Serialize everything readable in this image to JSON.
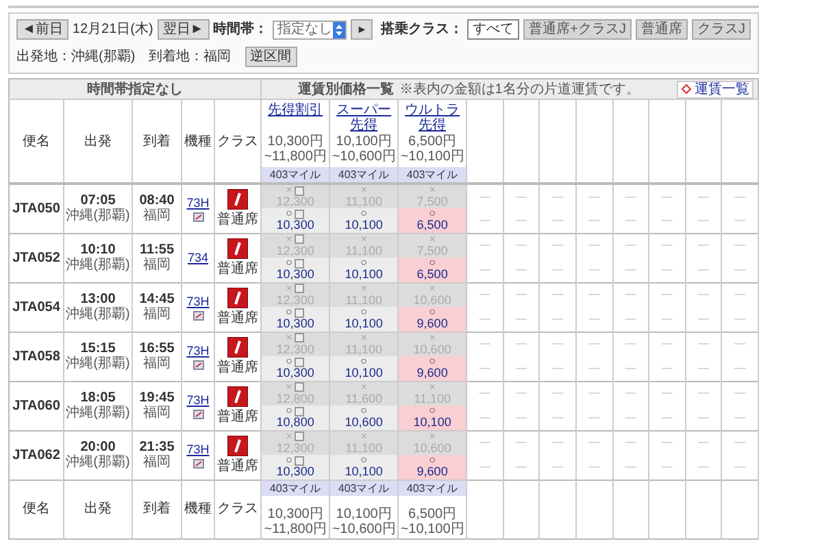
{
  "controls": {
    "prev_day": "◄前日",
    "date": "12月21日(木)",
    "next_day": "翌日►",
    "time_label": "時間帯：",
    "time_select": "指定なし",
    "go": "►",
    "class_label": "搭乗クラス：",
    "class_filters": [
      {
        "label": "すべて",
        "selected": true
      },
      {
        "label": "普通席+クラスJ",
        "selected": false
      },
      {
        "label": "普通席",
        "selected": false
      },
      {
        "label": "クラスJ",
        "selected": false
      }
    ],
    "origin": "出発地：沖縄(那覇)",
    "destination": "到着地：福岡",
    "reverse": "逆区間"
  },
  "table": {
    "time_header": "時間帯指定なし",
    "fare_header": "運賃別価格一覧",
    "fare_note": "※表内の金額は1名分の片道運賃です。",
    "fare_list_link": "運賃一覧",
    "columns": [
      "便名",
      "出発",
      "到着",
      "機種",
      "クラス"
    ],
    "fare_columns": [
      {
        "name": "先得割引",
        "price_from": "10,300円",
        "price_to": "~11,800円",
        "miles": "403マイル"
      },
      {
        "name": "スーパー先得",
        "price_from": "10,100円",
        "price_to": "~10,600円",
        "miles": "403マイル"
      },
      {
        "name": "ウルトラ先得",
        "price_from": "6,500円",
        "price_to": "~10,100円",
        "miles": "403マイル"
      }
    ],
    "flights": [
      {
        "number": "JTA050",
        "dep_time": "07:05",
        "dep_airport": "沖縄(那覇)",
        "arr_time": "08:40",
        "arr_airport": "福岡",
        "aircraft": "73H",
        "seatmap": true,
        "cabin": "普通席",
        "fares": [
          [
            {
              "mark": "×",
              "price": "12,300",
              "available": false,
              "badge": true,
              "lowest": false
            },
            {
              "mark": "○",
              "price": "10,300",
              "available": true,
              "badge": true,
              "lowest": false
            }
          ],
          [
            {
              "mark": "×",
              "price": "11,100",
              "available": false,
              "badge": false,
              "lowest": false
            },
            {
              "mark": "○",
              "price": "10,100",
              "available": true,
              "badge": false,
              "lowest": false
            }
          ],
          [
            {
              "mark": "×",
              "price": "7,500",
              "available": false,
              "badge": false,
              "lowest": false
            },
            {
              "mark": "○",
              "price": "6,500",
              "available": true,
              "badge": false,
              "lowest": true
            }
          ]
        ],
        "others": [
          [
            "—",
            "—"
          ],
          [
            "—",
            "—"
          ],
          [
            "—",
            "—"
          ],
          [
            "—",
            "—"
          ],
          [
            "—",
            "—"
          ],
          [
            "—",
            "—"
          ],
          [
            "—",
            "—"
          ],
          [
            "—",
            "—"
          ]
        ]
      },
      {
        "number": "JTA052",
        "dep_time": "10:10",
        "dep_airport": "沖縄(那覇)",
        "arr_time": "11:55",
        "arr_airport": "福岡",
        "aircraft": "734",
        "seatmap": false,
        "cabin": "普通席",
        "fares": [
          [
            {
              "mark": "×",
              "price": "12,300",
              "available": false,
              "badge": true,
              "lowest": false
            },
            {
              "mark": "○",
              "price": "10,300",
              "available": true,
              "badge": true,
              "lowest": false
            }
          ],
          [
            {
              "mark": "×",
              "price": "11,100",
              "available": false,
              "badge": false,
              "lowest": false
            },
            {
              "mark": "○",
              "price": "10,100",
              "available": true,
              "badge": false,
              "lowest": false
            }
          ],
          [
            {
              "mark": "×",
              "price": "7,500",
              "available": false,
              "badge": false,
              "lowest": false
            },
            {
              "mark": "○",
              "price": "6,500",
              "available": true,
              "badge": false,
              "lowest": true
            }
          ]
        ],
        "others": [
          [
            "—",
            "—"
          ],
          [
            "—",
            "—"
          ],
          [
            "—",
            "—"
          ],
          [
            "—",
            "—"
          ],
          [
            "—",
            "—"
          ],
          [
            "—",
            "—"
          ],
          [
            "—",
            "—"
          ],
          [
            "—",
            "—"
          ]
        ]
      },
      {
        "number": "JTA054",
        "dep_time": "13:00",
        "dep_airport": "沖縄(那覇)",
        "arr_time": "14:45",
        "arr_airport": "福岡",
        "aircraft": "73H",
        "seatmap": true,
        "cabin": "普通席",
        "fares": [
          [
            {
              "mark": "×",
              "price": "12,300",
              "available": false,
              "badge": true,
              "lowest": false
            },
            {
              "mark": "○",
              "price": "10,300",
              "available": true,
              "badge": true,
              "lowest": false
            }
          ],
          [
            {
              "mark": "×",
              "price": "11,100",
              "available": false,
              "badge": false,
              "lowest": false
            },
            {
              "mark": "○",
              "price": "10,100",
              "available": true,
              "badge": false,
              "lowest": false
            }
          ],
          [
            {
              "mark": "×",
              "price": "10,600",
              "available": false,
              "badge": false,
              "lowest": false
            },
            {
              "mark": "○",
              "price": "9,600",
              "available": true,
              "badge": false,
              "lowest": true
            }
          ]
        ],
        "others": [
          [
            "—",
            "—"
          ],
          [
            "—",
            "—"
          ],
          [
            "—",
            "—"
          ],
          [
            "—",
            "—"
          ],
          [
            "—",
            "—"
          ],
          [
            "—",
            "—"
          ],
          [
            "—",
            "—"
          ],
          [
            "—",
            "—"
          ]
        ]
      },
      {
        "number": "JTA058",
        "dep_time": "15:15",
        "dep_airport": "沖縄(那覇)",
        "arr_time": "16:55",
        "arr_airport": "福岡",
        "aircraft": "73H",
        "seatmap": true,
        "cabin": "普通席",
        "fares": [
          [
            {
              "mark": "×",
              "price": "12,300",
              "available": false,
              "badge": true,
              "lowest": false
            },
            {
              "mark": "○",
              "price": "10,300",
              "available": true,
              "badge": true,
              "lowest": false
            }
          ],
          [
            {
              "mark": "×",
              "price": "11,100",
              "available": false,
              "badge": false,
              "lowest": false
            },
            {
              "mark": "○",
              "price": "10,100",
              "available": true,
              "badge": false,
              "lowest": false
            }
          ],
          [
            {
              "mark": "×",
              "price": "10,600",
              "available": false,
              "badge": false,
              "lowest": false
            },
            {
              "mark": "○",
              "price": "9,600",
              "available": true,
              "badge": false,
              "lowest": true
            }
          ]
        ],
        "others": [
          [
            "—",
            "—"
          ],
          [
            "—",
            "—"
          ],
          [
            "—",
            "—"
          ],
          [
            "—",
            "—"
          ],
          [
            "—",
            "—"
          ],
          [
            "—",
            "—"
          ],
          [
            "—",
            "—"
          ],
          [
            "—",
            "—"
          ]
        ]
      },
      {
        "number": "JTA060",
        "dep_time": "18:05",
        "dep_airport": "沖縄(那覇)",
        "arr_time": "19:45",
        "arr_airport": "福岡",
        "aircraft": "73H",
        "seatmap": true,
        "cabin": "普通席",
        "fares": [
          [
            {
              "mark": "×",
              "price": "12,800",
              "available": false,
              "badge": true,
              "lowest": false
            },
            {
              "mark": "○",
              "price": "10,800",
              "available": true,
              "badge": true,
              "lowest": false
            }
          ],
          [
            {
              "mark": "×",
              "price": "11,600",
              "available": false,
              "badge": false,
              "lowest": false
            },
            {
              "mark": "○",
              "price": "10,600",
              "available": true,
              "badge": false,
              "lowest": false
            }
          ],
          [
            {
              "mark": "×",
              "price": "11,100",
              "available": false,
              "badge": false,
              "lowest": false
            },
            {
              "mark": "○",
              "price": "10,100",
              "available": true,
              "badge": false,
              "lowest": true
            }
          ]
        ],
        "others": [
          [
            "—",
            "—"
          ],
          [
            "—",
            "—"
          ],
          [
            "—",
            "—"
          ],
          [
            "—",
            "—"
          ],
          [
            "—",
            "—"
          ],
          [
            "—",
            "—"
          ],
          [
            "—",
            "—"
          ],
          [
            "—",
            "—"
          ]
        ]
      },
      {
        "number": "JTA062",
        "dep_time": "20:00",
        "dep_airport": "沖縄(那覇)",
        "arr_time": "21:35",
        "arr_airport": "福岡",
        "aircraft": "73H",
        "seatmap": true,
        "cabin": "普通席",
        "fares": [
          [
            {
              "mark": "×",
              "price": "12,300",
              "available": false,
              "badge": true,
              "lowest": false
            },
            {
              "mark": "○",
              "price": "10,300",
              "available": true,
              "badge": true,
              "lowest": false
            }
          ],
          [
            {
              "mark": "×",
              "price": "11,100",
              "available": false,
              "badge": false,
              "lowest": false
            },
            {
              "mark": "○",
              "price": "10,100",
              "available": true,
              "badge": false,
              "lowest": false
            }
          ],
          [
            {
              "mark": "×",
              "price": "10,600",
              "available": false,
              "badge": false,
              "lowest": false
            },
            {
              "mark": "○",
              "price": "9,600",
              "available": true,
              "badge": false,
              "lowest": true
            }
          ]
        ],
        "others": [
          [
            "—",
            "—"
          ],
          [
            "—",
            "—"
          ],
          [
            "—",
            "—"
          ],
          [
            "—",
            "—"
          ],
          [
            "—",
            "—"
          ],
          [
            "—",
            "—"
          ],
          [
            "—",
            "—"
          ],
          [
            "—",
            "—"
          ]
        ]
      }
    ],
    "footer_columns": [
      "便名",
      "出発",
      "到着",
      "機種",
      "クラス"
    ],
    "footer_fares": [
      {
        "miles": "403マイル",
        "price_from": "10,300円",
        "price_to": "~11,800円"
      },
      {
        "miles": "403マイル",
        "price_from": "10,100円",
        "price_to": "~10,600円"
      },
      {
        "miles": "403マイル",
        "price_from": "6,500円",
        "price_to": "~10,100円"
      }
    ]
  }
}
